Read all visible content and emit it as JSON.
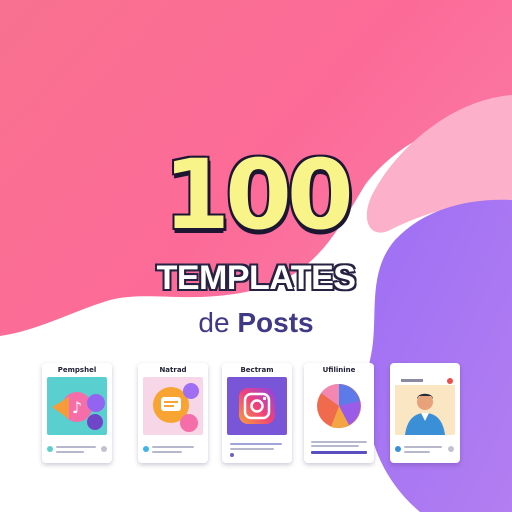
{
  "hero": {
    "number": "100",
    "title": "TEMPLATES",
    "subtitle_prefix": "de",
    "subtitle_emphasis": "Posts"
  },
  "cards": [
    {
      "title": "Pempshel",
      "theme": "music"
    },
    {
      "title": "Natrad",
      "theme": "chat"
    },
    {
      "title": "Bectram",
      "theme": "instagram"
    },
    {
      "title": "Ufilinine",
      "theme": "pie-chart"
    },
    {
      "title": "",
      "theme": "person"
    }
  ],
  "colors": {
    "pink": "#fb6d95",
    "light_pink": "#fca8c2",
    "purple": "#a774f2",
    "headline_yellow": "#f8f48a",
    "subtitle": "#403a86"
  }
}
